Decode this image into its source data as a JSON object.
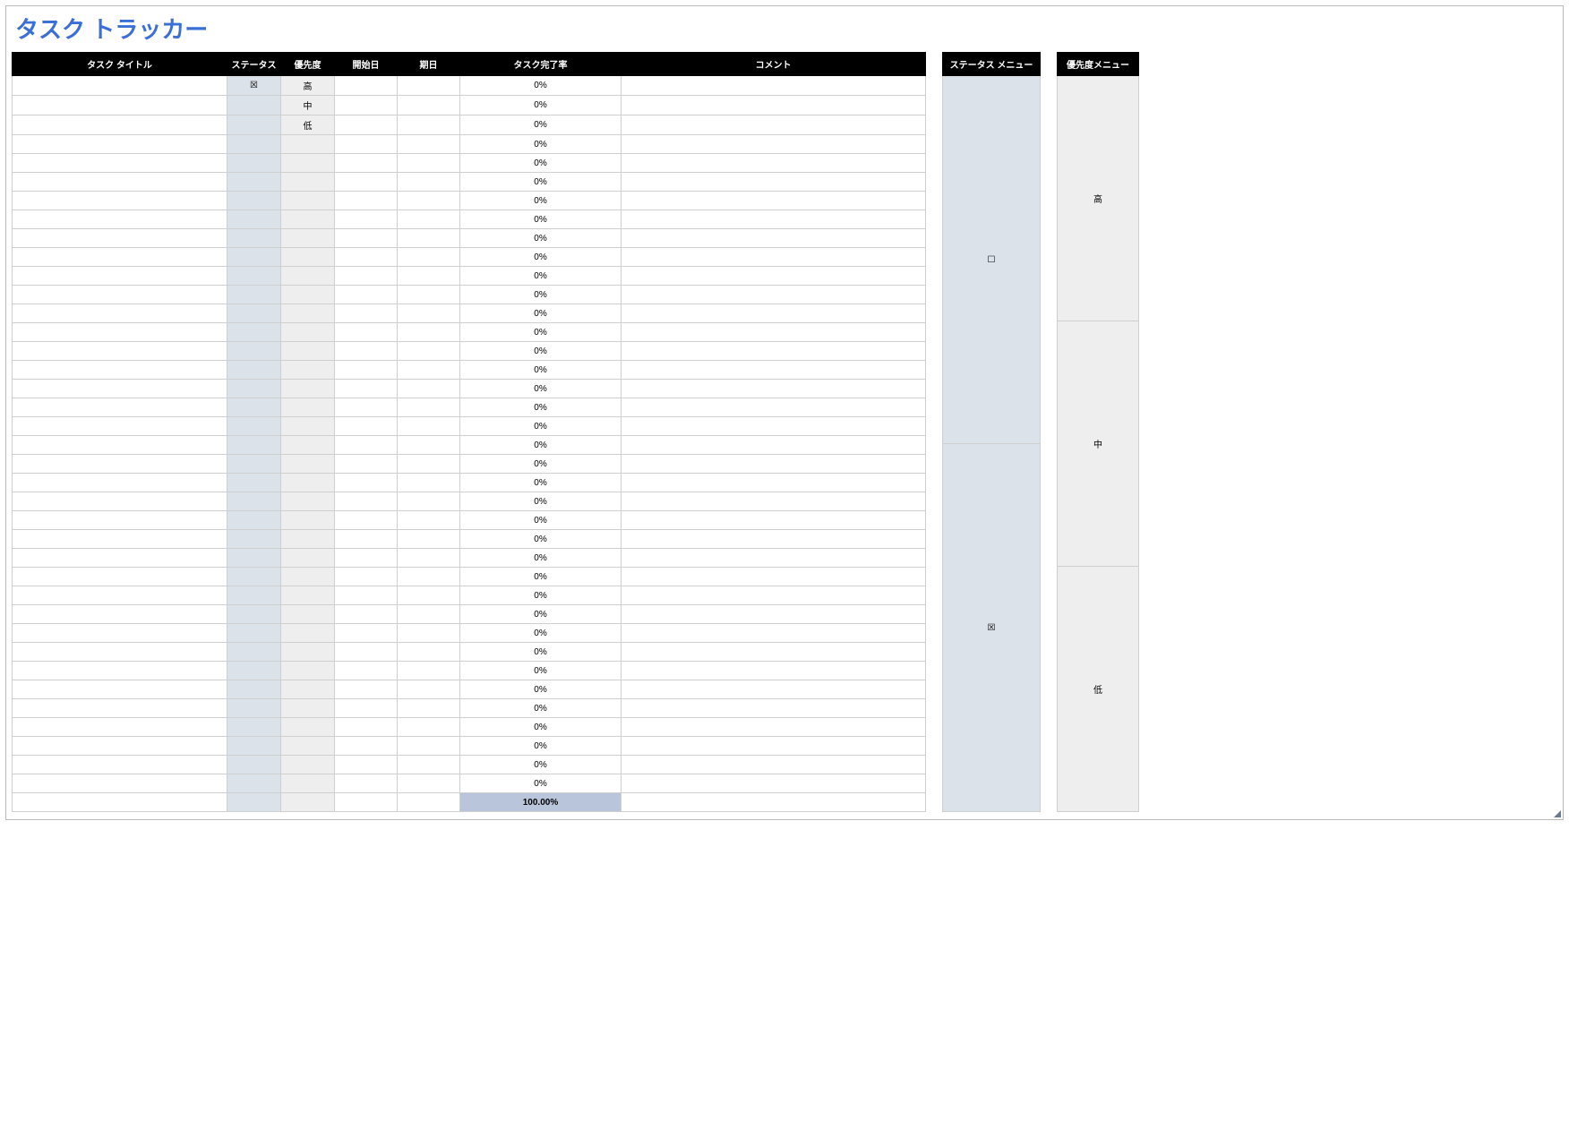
{
  "title": "タスク トラッカー",
  "main_table": {
    "headers": {
      "task_title": "タスク タイトル",
      "status": "ステータス",
      "priority": "優先度",
      "start_date": "開始日",
      "due_date": "期日",
      "completion": "タスク完了率",
      "comment": "コメント"
    },
    "rows": [
      {
        "title": "",
        "status": "☒",
        "priority": "高",
        "start": "",
        "due": "",
        "completion": "0%",
        "comment": ""
      },
      {
        "title": "",
        "status": "",
        "priority": "中",
        "start": "",
        "due": "",
        "completion": "0%",
        "comment": ""
      },
      {
        "title": "",
        "status": "",
        "priority": "低",
        "start": "",
        "due": "",
        "completion": "0%",
        "comment": ""
      },
      {
        "title": "",
        "status": "",
        "priority": "",
        "start": "",
        "due": "",
        "completion": "0%",
        "comment": ""
      },
      {
        "title": "",
        "status": "",
        "priority": "",
        "start": "",
        "due": "",
        "completion": "0%",
        "comment": ""
      },
      {
        "title": "",
        "status": "",
        "priority": "",
        "start": "",
        "due": "",
        "completion": "0%",
        "comment": ""
      },
      {
        "title": "",
        "status": "",
        "priority": "",
        "start": "",
        "due": "",
        "completion": "0%",
        "comment": ""
      },
      {
        "title": "",
        "status": "",
        "priority": "",
        "start": "",
        "due": "",
        "completion": "0%",
        "comment": "",
        "sep": true
      },
      {
        "title": "",
        "status": "",
        "priority": "",
        "start": "",
        "due": "",
        "completion": "0%",
        "comment": ""
      },
      {
        "title": "",
        "status": "",
        "priority": "",
        "start": "",
        "due": "",
        "completion": "0%",
        "comment": ""
      },
      {
        "title": "",
        "status": "",
        "priority": "",
        "start": "",
        "due": "",
        "completion": "0%",
        "comment": ""
      },
      {
        "title": "",
        "status": "",
        "priority": "",
        "start": "",
        "due": "",
        "completion": "0%",
        "comment": ""
      },
      {
        "title": "",
        "status": "",
        "priority": "",
        "start": "",
        "due": "",
        "completion": "0%",
        "comment": ""
      },
      {
        "title": "",
        "status": "",
        "priority": "",
        "start": "",
        "due": "",
        "completion": "0%",
        "comment": ""
      },
      {
        "title": "",
        "status": "",
        "priority": "",
        "start": "",
        "due": "",
        "completion": "0%",
        "comment": ""
      },
      {
        "title": "",
        "status": "",
        "priority": "",
        "start": "",
        "due": "",
        "completion": "0%",
        "comment": ""
      },
      {
        "title": "",
        "status": "",
        "priority": "",
        "start": "",
        "due": "",
        "completion": "0%",
        "comment": ""
      },
      {
        "title": "",
        "status": "",
        "priority": "",
        "start": "",
        "due": "",
        "completion": "0%",
        "comment": ""
      },
      {
        "title": "",
        "status": "",
        "priority": "",
        "start": "",
        "due": "",
        "completion": "0%",
        "comment": ""
      },
      {
        "title": "",
        "status": "",
        "priority": "",
        "start": "",
        "due": "",
        "completion": "0%",
        "comment": ""
      },
      {
        "title": "",
        "status": "",
        "priority": "",
        "start": "",
        "due": "",
        "completion": "0%",
        "comment": ""
      },
      {
        "title": "",
        "status": "",
        "priority": "",
        "start": "",
        "due": "",
        "completion": "0%",
        "comment": ""
      },
      {
        "title": "",
        "status": "",
        "priority": "",
        "start": "",
        "due": "",
        "completion": "0%",
        "comment": ""
      },
      {
        "title": "",
        "status": "",
        "priority": "",
        "start": "",
        "due": "",
        "completion": "0%",
        "comment": ""
      },
      {
        "title": "",
        "status": "",
        "priority": "",
        "start": "",
        "due": "",
        "completion": "0%",
        "comment": ""
      },
      {
        "title": "",
        "status": "",
        "priority": "",
        "start": "",
        "due": "",
        "completion": "0%",
        "comment": ""
      },
      {
        "title": "",
        "status": "",
        "priority": "",
        "start": "",
        "due": "",
        "completion": "0%",
        "comment": ""
      },
      {
        "title": "",
        "status": "",
        "priority": "",
        "start": "",
        "due": "",
        "completion": "0%",
        "comment": ""
      },
      {
        "title": "",
        "status": "",
        "priority": "",
        "start": "",
        "due": "",
        "completion": "0%",
        "comment": "",
        "sep": true
      },
      {
        "title": "",
        "status": "",
        "priority": "",
        "start": "",
        "due": "",
        "completion": "0%",
        "comment": ""
      },
      {
        "title": "",
        "status": "",
        "priority": "",
        "start": "",
        "due": "",
        "completion": "0%",
        "comment": ""
      },
      {
        "title": "",
        "status": "",
        "priority": "",
        "start": "",
        "due": "",
        "completion": "0%",
        "comment": ""
      },
      {
        "title": "",
        "status": "",
        "priority": "",
        "start": "",
        "due": "",
        "completion": "0%",
        "comment": ""
      },
      {
        "title": "",
        "status": "",
        "priority": "",
        "start": "",
        "due": "",
        "completion": "0%",
        "comment": ""
      },
      {
        "title": "",
        "status": "",
        "priority": "",
        "start": "",
        "due": "",
        "completion": "0%",
        "comment": ""
      },
      {
        "title": "",
        "status": "",
        "priority": "",
        "start": "",
        "due": "",
        "completion": "0%",
        "comment": ""
      },
      {
        "title": "",
        "status": "",
        "priority": "",
        "start": "",
        "due": "",
        "completion": "0%",
        "comment": ""
      },
      {
        "title": "",
        "status": "",
        "priority": "",
        "start": "",
        "due": "",
        "completion": "0%",
        "comment": ""
      }
    ],
    "footer_completion": "100.00%"
  },
  "status_menu": {
    "header": "ステータス メニュー",
    "items": [
      "☐",
      "☒"
    ]
  },
  "priority_menu": {
    "header": "優先度メニュー",
    "items": [
      "高",
      "中",
      "低"
    ]
  }
}
